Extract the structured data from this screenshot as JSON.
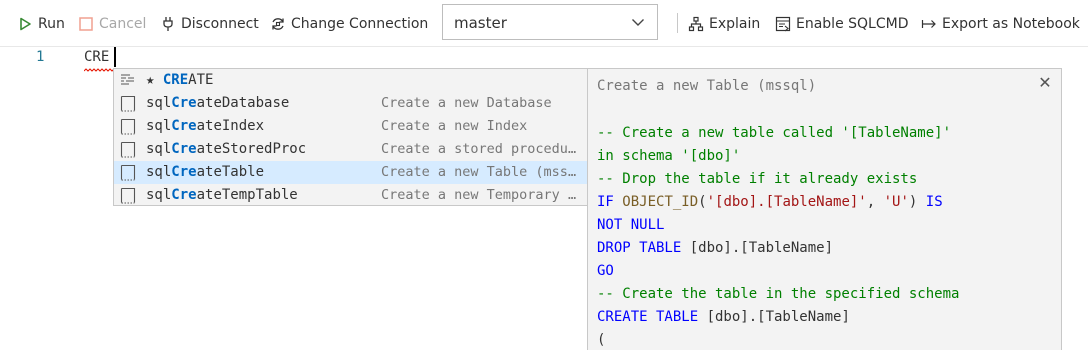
{
  "toolbar": {
    "run_label": "Run",
    "cancel_label": "Cancel",
    "disconnect_label": "Disconnect",
    "change_connection_label": "Change Connection",
    "database_selected": "master",
    "explain_label": "Explain",
    "sqlcmd_label": "Enable SQLCMD",
    "export_label": "Export as Notebook"
  },
  "editor": {
    "line_number": "1",
    "typed_text": "CRE"
  },
  "suggest": {
    "items": [
      {
        "match": "CRE",
        "rest": "ATE",
        "prefix": "★ ",
        "desc": "",
        "icon": "keyword-icon"
      },
      {
        "pre": "sql",
        "match": "Cre",
        "rest": "ateDatabase",
        "desc": "Create a new Database",
        "icon": "snippet-icon"
      },
      {
        "pre": "sql",
        "match": "Cre",
        "rest": "ateIndex",
        "desc": "Create a new Index",
        "icon": "snippet-icon"
      },
      {
        "pre": "sql",
        "match": "Cre",
        "rest": "ateStoredProc",
        "desc": "Create a stored procedure",
        "icon": "snippet-icon"
      },
      {
        "pre": "sql",
        "match": "Cre",
        "rest": "ateTable",
        "desc": "Create a new Table (mssql)",
        "icon": "snippet-icon"
      },
      {
        "pre": "sql",
        "match": "Cre",
        "rest": "ateTempTable",
        "desc": "Create a new Temporary Table",
        "icon": "snippet-icon"
      }
    ]
  },
  "details": {
    "title": "Create a new Table (mssql)",
    "lines": [
      [
        [
          "c-com",
          "-- Create a new table called '[TableName]'"
        ]
      ],
      [
        [
          "c-com",
          "in schema '[dbo]'"
        ]
      ],
      [
        [
          "c-com",
          "-- Drop the table if it already exists"
        ]
      ],
      [
        [
          "c-kw",
          "IF "
        ],
        [
          "c-fn",
          "OBJECT_ID"
        ],
        [
          "c-txt",
          "("
        ],
        [
          "c-str",
          "'[dbo].[TableName]'"
        ],
        [
          "c-txt",
          ", "
        ],
        [
          "c-str",
          "'U'"
        ],
        [
          "c-txt",
          ") "
        ],
        [
          "c-kw",
          "IS"
        ]
      ],
      [
        [
          "c-kw",
          "NOT NULL"
        ]
      ],
      [
        [
          "c-kw",
          "DROP TABLE "
        ],
        [
          "c-txt",
          "[dbo].[TableName]"
        ]
      ],
      [
        [
          "c-kw",
          "GO"
        ]
      ],
      [
        [
          "c-com",
          "-- Create the table in the specified schema"
        ]
      ],
      [
        [
          "c-kw",
          "CREATE TABLE "
        ],
        [
          "c-txt",
          "[dbo].[TableName]"
        ]
      ],
      [
        [
          "c-txt",
          "("
        ]
      ]
    ]
  }
}
